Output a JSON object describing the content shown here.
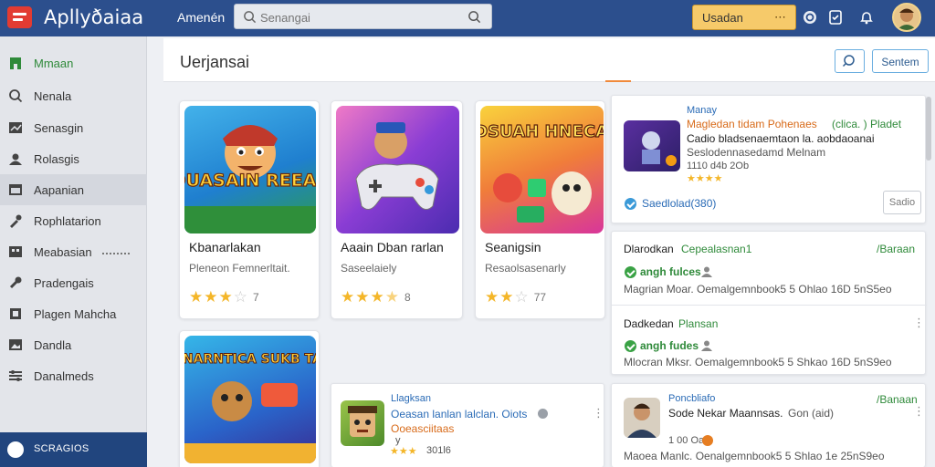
{
  "app": {
    "title": "Apllyðaiaa"
  },
  "topbar": {
    "link": "Amenén",
    "search_placeholder": "Senangai",
    "button_label": "Usadan",
    "button_more": "⋯"
  },
  "sidebar": {
    "items": [
      {
        "label": "Mmaan",
        "icon": "home-icon"
      },
      {
        "label": "Nenala",
        "icon": "search-icon"
      },
      {
        "label": "Senasgin",
        "icon": "chart-icon"
      },
      {
        "label": "Rolasgis",
        "icon": "users-icon"
      },
      {
        "label": "Aapanian",
        "icon": "window-icon"
      },
      {
        "label": "Rophlatarion",
        "icon": "tool-icon"
      },
      {
        "label": "Meabasian",
        "icon": "grid-icon"
      },
      {
        "label": "Pradengais",
        "icon": "link-icon"
      },
      {
        "label": "Plagen Mahcha",
        "icon": "tag-icon"
      },
      {
        "label": "Dandla",
        "icon": "image-icon"
      },
      {
        "label": "Danalmeds",
        "icon": "slider-icon"
      }
    ],
    "bottom_label": "SCRAGIOS"
  },
  "main": {
    "title": "Uerjansai",
    "header_button": "Sentem"
  },
  "apps": [
    {
      "name": "Kbanarlakan",
      "sub": "Pleneon Femnerltait.",
      "rating": 3.5,
      "rating_label": "7",
      "thumb_text": "DUASAIN REEAS"
    },
    {
      "name": "Aaain Dban rarlan",
      "sub": "Saseelaiely",
      "rating": 3.5,
      "rating_label": "8",
      "thumb_text": ""
    },
    {
      "name": "Seanigsin",
      "sub": "Resaolsasenarly",
      "rating": 2.5,
      "rating_label": "77",
      "thumb_text": "FADSUAH HNECARS"
    },
    {
      "name": "",
      "sub": "",
      "rating": 0,
      "rating_label": "",
      "thumb_text": "LEKENARNTICA SUKB TAHAD"
    }
  ],
  "detail_top": {
    "kicker": "Manay",
    "title": "Magledan tidam Pohenaes",
    "title_suffix": "(clica. ) Pladet",
    "line2": "Cadio bladsenaemtaon la. aobdaoanai",
    "line3": "Seslodennasedamd Melnam",
    "meta": "1110 d4b 2Ob",
    "stars": "★★★★",
    "verified": "Saedlolad(380)",
    "button": "Sadio"
  },
  "detail_mid": {
    "row1": {
      "title": "Dlarodkan",
      "title2": "Cepealasnan1",
      "action": "/Baraan",
      "badge": "angh fulces",
      "desc": "Magrian Moar. Oemalgemnbook5 5 Ohlao 16D 5nS5eo"
    },
    "row2": {
      "title": "Dadkedan",
      "title2": "Plansan",
      "badge": "angh fudes",
      "desc": "Mlocran Mksr. Oemalgemnbook5 5 Shkao 16D 5nS9eo"
    }
  },
  "card_small": {
    "kicker": "Llagksan",
    "title": "Oeasan lanlan lalclan. Oiots",
    "sub": "Ooeasciitaas",
    "sub2": "y",
    "meta": "301l6",
    "stars": "★★★"
  },
  "detail_bottom": {
    "kicker": "Poncbliafo",
    "title": "Sode Nekar Maannsas.",
    "title_suffix": "Gon (aid)",
    "action": "/Banaan",
    "meta": "1 00 Oa3",
    "desc": "Maoea Manlc. Oenalgemnbook5 5 Shlao 1e 25nS9eo"
  },
  "colors": {
    "topbar": "#2c4f8d",
    "accent_green": "#2f8a3a",
    "star": "#f4b629",
    "button_yellow": "#f6ca6a"
  }
}
